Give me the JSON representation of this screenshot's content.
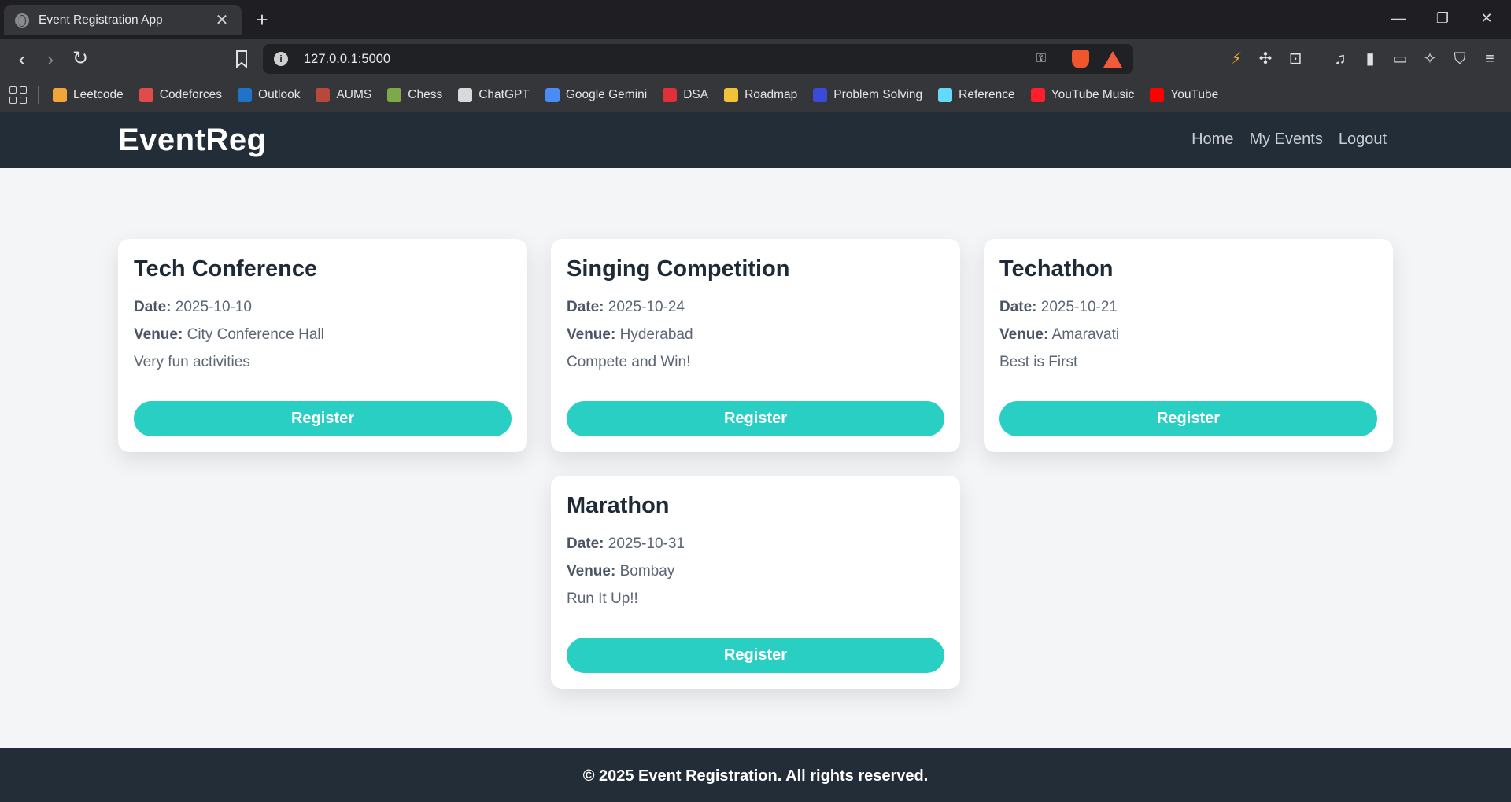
{
  "browser": {
    "tab_title": "Event Registration App",
    "url": "127.0.0.1:5000",
    "bookmarks": [
      {
        "label": "Leetcode",
        "color": "#f0a53a"
      },
      {
        "label": "Codeforces",
        "color": "#e04b4b"
      },
      {
        "label": "Outlook",
        "color": "#1f73c9"
      },
      {
        "label": "AUMS",
        "color": "#b8483c"
      },
      {
        "label": "Chess",
        "color": "#7ea84a"
      },
      {
        "label": "ChatGPT",
        "color": "#d9d9d9"
      },
      {
        "label": "Google Gemini",
        "color": "#4b8bf5"
      },
      {
        "label": "DSA",
        "color": "#e0303a"
      },
      {
        "label": "Roadmap",
        "color": "#f0c23a"
      },
      {
        "label": "Problem Solving",
        "color": "#3b4bd8"
      },
      {
        "label": "Reference",
        "color": "#61dafb"
      },
      {
        "label": "YouTube Music",
        "color": "#ff1e2d"
      },
      {
        "label": "YouTube",
        "color": "#ff0000"
      }
    ]
  },
  "site": {
    "brand": "EventReg",
    "nav": [
      "Home",
      "My Events",
      "Logout"
    ]
  },
  "labels": {
    "date": "Date:",
    "venue": "Venue:",
    "register": "Register"
  },
  "events": [
    {
      "title": "Tech Conference",
      "date": "2025-10-10",
      "venue": "City Conference Hall",
      "description": "Very fun activities"
    },
    {
      "title": "Singing Competition",
      "date": "2025-10-24",
      "venue": "Hyderabad",
      "description": "Compete and Win!"
    },
    {
      "title": "Techathon",
      "date": "2025-10-21",
      "venue": "Amaravati",
      "description": "Best is First"
    },
    {
      "title": "Marathon",
      "date": "2025-10-31",
      "venue": "Bombay",
      "description": "Run It Up!!"
    }
  ],
  "footer": "© 2025 Event Registration. All rights reserved.",
  "colors": {
    "header_bg": "#222d38",
    "accent": "#2acfc3",
    "page_bg": "#f4f5f7"
  }
}
